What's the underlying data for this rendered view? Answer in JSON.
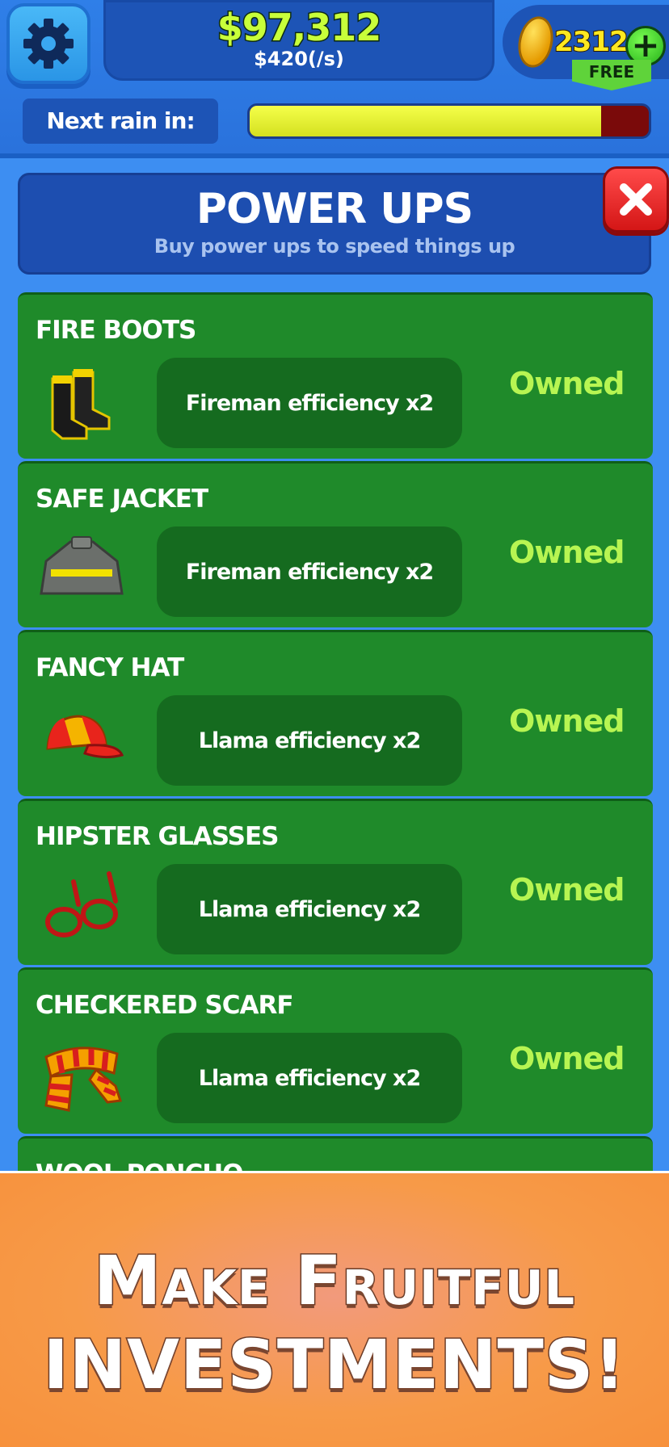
{
  "header": {
    "money": "$97,312",
    "rate": "$420(/s)",
    "gems": "2312",
    "plus_symbol": "+",
    "free_label": "FREE",
    "rain_label": "Next rain in:",
    "rain_progress": 0.88
  },
  "panel": {
    "title": "POWER UPS",
    "subtitle": "Buy power ups to speed things up",
    "close_symbol": "✕"
  },
  "items": [
    {
      "name": "FIRE BOOTS",
      "desc": "Fireman efficiency x2",
      "status": "Owned",
      "icon": "boots-icon"
    },
    {
      "name": "SAFE JACKET",
      "desc": "Fireman efficiency x2",
      "status": "Owned",
      "icon": "jacket-icon"
    },
    {
      "name": "FANCY HAT",
      "desc": "Llama efficiency x2",
      "status": "Owned",
      "icon": "cap-icon"
    },
    {
      "name": "HIPSTER GLASSES",
      "desc": "Llama efficiency x2",
      "status": "Owned",
      "icon": "glasses-icon"
    },
    {
      "name": "CHECKERED SCARF",
      "desc": "Llama efficiency x2",
      "status": "Owned",
      "icon": "scarf-icon"
    }
  ],
  "peek_item": {
    "name": "WOOL PONCHO"
  },
  "promo": {
    "line1": "Make Fruitful",
    "line2": "INVESTMENTS!"
  },
  "colors": {
    "accent_green": "#1f8a2a",
    "owned_text": "#b7f552",
    "money_text": "#c8ff3a",
    "close_red": "#e52020"
  }
}
